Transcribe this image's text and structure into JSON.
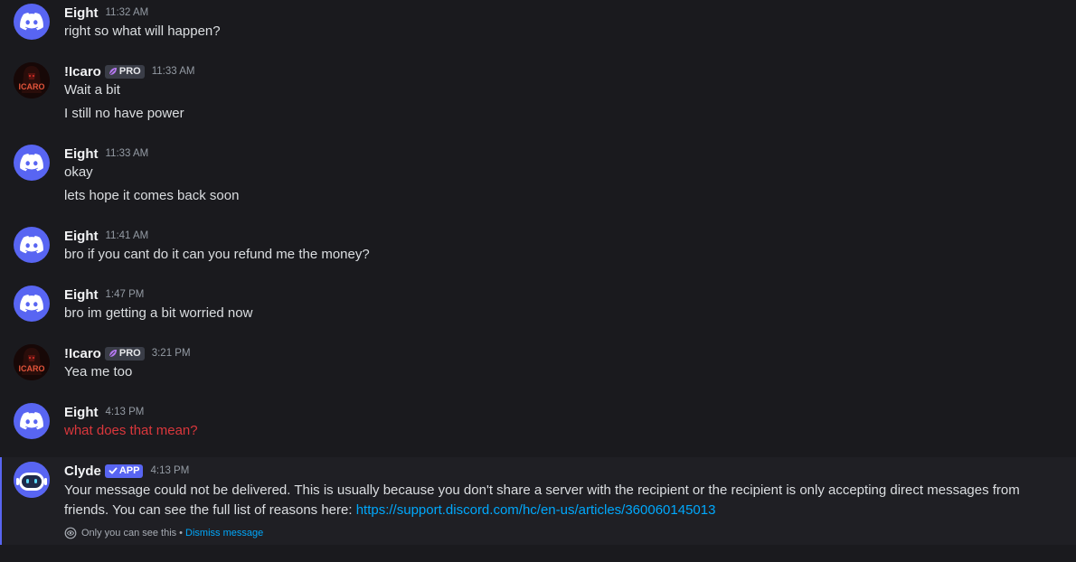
{
  "colors": {
    "background": "#1a1a1e",
    "username": "#f2f3f5",
    "message_text": "#dbdee1",
    "timestamp": "#949ba4",
    "failed_text": "#da373c",
    "link": "#00a8fc",
    "blurple": "#5865f2"
  },
  "messages": [
    {
      "author": "Eight",
      "avatar_icon": "discord-logo-icon",
      "timestamp": "11:32 AM",
      "lines": [
        "right so what will happen?"
      ]
    },
    {
      "author": "!Icaro",
      "avatar_icon": "icaro-avatar",
      "avatar_text": "ICARO",
      "badge": "PRO",
      "badge_icon": "leaf-icon",
      "timestamp": "11:33 AM",
      "lines": [
        "Wait a bit",
        "I still no have power"
      ]
    },
    {
      "author": "Eight",
      "avatar_icon": "discord-logo-icon",
      "timestamp": "11:33 AM",
      "lines": [
        "okay",
        "lets hope it comes back soon"
      ]
    },
    {
      "author": "Eight",
      "avatar_icon": "discord-logo-icon",
      "timestamp": "11:41 AM",
      "lines": [
        "bro if you cant do it can you refund me the money?"
      ]
    },
    {
      "author": "Eight",
      "avatar_icon": "discord-logo-icon",
      "timestamp": "1:47 PM",
      "lines": [
        "bro im getting a bit worried now"
      ]
    },
    {
      "author": "!Icaro",
      "avatar_icon": "icaro-avatar",
      "avatar_text": "ICARO",
      "badge": "PRO",
      "badge_icon": "leaf-icon",
      "timestamp": "3:21 PM",
      "lines": [
        "Yea me too"
      ]
    },
    {
      "author": "Eight",
      "avatar_icon": "discord-logo-icon",
      "timestamp": "4:13 PM",
      "lines": [
        "what does that mean?"
      ],
      "status": "failed"
    }
  ],
  "clyde": {
    "author": "Clyde",
    "avatar_icon": "clyde-bot-icon",
    "badge": "APP",
    "badge_icon": "checkmark-icon",
    "timestamp": "4:13 PM",
    "text": "Your message could not be delivered. This is usually because you don't share a server with the recipient or the recipient is only accepting direct messages from friends. You can see the full list of reasons here: ",
    "link_text": "https://support.discord.com/hc/en-us/articles/360060145013",
    "ephemeral_note": "Only you can see this",
    "separator": "•",
    "dismiss_label": "Dismiss message"
  }
}
